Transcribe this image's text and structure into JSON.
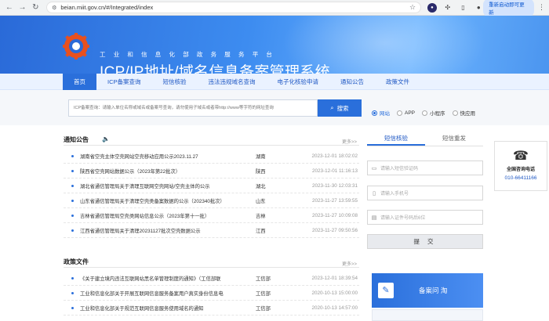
{
  "browser": {
    "url": "beian.miit.gov.cn/#/Integrated/index",
    "relaunch_label": "重新启动即可更新"
  },
  "header": {
    "org": "工业和信息化部政务服务平台",
    "title": "ICP/IP地址/域名信息备案管理系统"
  },
  "nav": [
    "首页",
    "ICP备案查询",
    "短信核验",
    "违法违规域名查询",
    "电子化核验申请",
    "通知公告",
    "政策文件"
  ],
  "search": {
    "placeholder": "ICP备案查询：请输入单位名称或域名或备案号查询，请勿使用子域名或者带http://www等字符的网址查询",
    "button": "搜索",
    "options": [
      "网站",
      "APP",
      "小程序",
      "快应用"
    ]
  },
  "notices": {
    "title": "通知公告",
    "more": "更多>>",
    "items": [
      {
        "title": "湖南省空壳主体空壳网站空壳移动应用公示2023.11.27",
        "province": "湖南",
        "date": "2023-12-01 18:02:02"
      },
      {
        "title": "陕西省空壳网站数据公示（2023年第22批次）",
        "province": "陕西",
        "date": "2023-12-01 11:16:13"
      },
      {
        "title": "湖北省通信管理局关于清理互联网空壳网站/空壳主体的公示",
        "province": "湖北",
        "date": "2023-11-30 12:03:31"
      },
      {
        "title": "山东省通信管理局关于清理空壳类备案数据的公示（202340批次）",
        "province": "山东",
        "date": "2023-11-27 13:59:55"
      },
      {
        "title": "吉林省通信管理局空壳类网站信息公示（2023年第十一批）",
        "province": "吉林",
        "date": "2023-11-27 10:09:08"
      },
      {
        "title": "江西省通信管理局关于清理20231127批次空壳数据公示",
        "province": "江西",
        "date": "2023-11-27 09:50:56"
      }
    ]
  },
  "policies": {
    "title": "政策文件",
    "more": "更多>>",
    "items": [
      {
        "title": "《关于建立境内违法互联网站黑名单管理制度的通知》（工信部联",
        "province": "工信部",
        "date": "2023-12-01 18:39:54"
      },
      {
        "title": "工业和信息化部关于开展互联网信息服务备案用户真实身份信息电",
        "province": "工信部",
        "date": "2020-10-13 15:00:00"
      },
      {
        "title": "工业和信息化部关于规范互联网信息服务使用域名的通知",
        "province": "工信部",
        "date": "2020-10-13 14:57:00"
      }
    ]
  },
  "sms": {
    "tabs": [
      "短信核验",
      "短信重发"
    ],
    "code_placeholder": "请输入短信验证码",
    "phone_placeholder": "请输入手机号",
    "id_placeholder": "请输入证件号码后6位",
    "submit": "提 交"
  },
  "hotline": {
    "label": "全国咨询电话",
    "number": "010-66411166"
  },
  "beian_card": {
    "label": "备案问 淘"
  },
  "colors": {
    "primary": "#2a6fdb",
    "nav_bg": "#eaf2ff"
  }
}
